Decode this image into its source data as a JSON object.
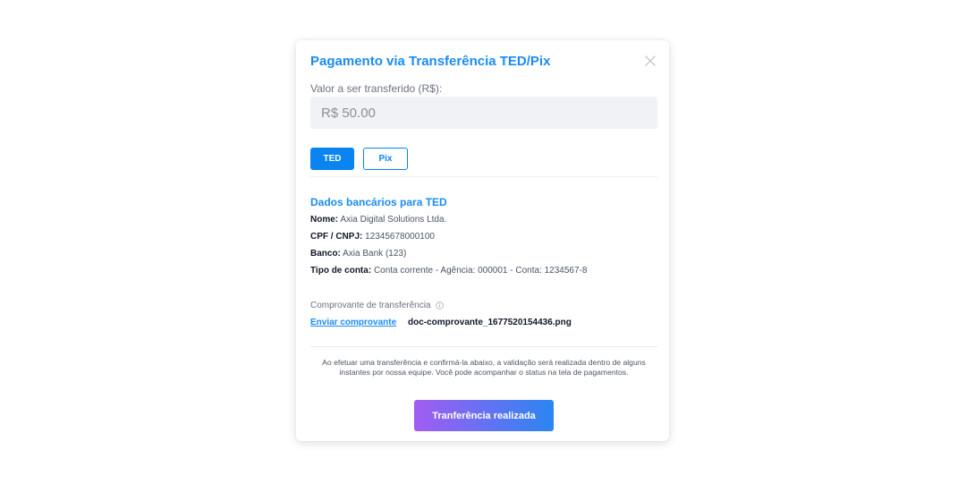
{
  "modal": {
    "title": "Pagamento via Transferência TED/Pix",
    "amount_label": "Valor a ser transferido (R$):",
    "amount_value": "R$ 50.00",
    "tabs": [
      {
        "label": "TED",
        "active": true
      },
      {
        "label": "Pix",
        "active": false
      }
    ],
    "bank": {
      "title": "Dados bancários para TED",
      "name_label": "Nome:",
      "name_value": "Axia Digital Solutions Ltda.",
      "doc_label": "CPF / CNPJ:",
      "doc_value": "12345678000100",
      "bank_label": "Banco:",
      "bank_value": "Axia Bank (123)",
      "account_label": "Tipo de conta:",
      "account_value": "Conta corrente - Agência: 000001 - Conta: 1234567-8"
    },
    "receipt": {
      "label": "Comprovante de transferência",
      "upload_link": "Enviar comprovante",
      "file_name": "doc-comprovante_1677520154436.png"
    },
    "notice": "Ao efetuar uma transferência e confirmá-la abaixo, a validação será realizada dentro de alguns instantes por nossa equipe. Você pode acompanhar o status na tela de pagamentos.",
    "confirm_button": "Tranferência realizada"
  },
  "colors": {
    "accent": "#1a8cf0",
    "gradient_start": "#a35cf2",
    "gradient_end": "#2a86f2"
  },
  "icons": {
    "close": "close-icon",
    "info": "info-icon"
  }
}
